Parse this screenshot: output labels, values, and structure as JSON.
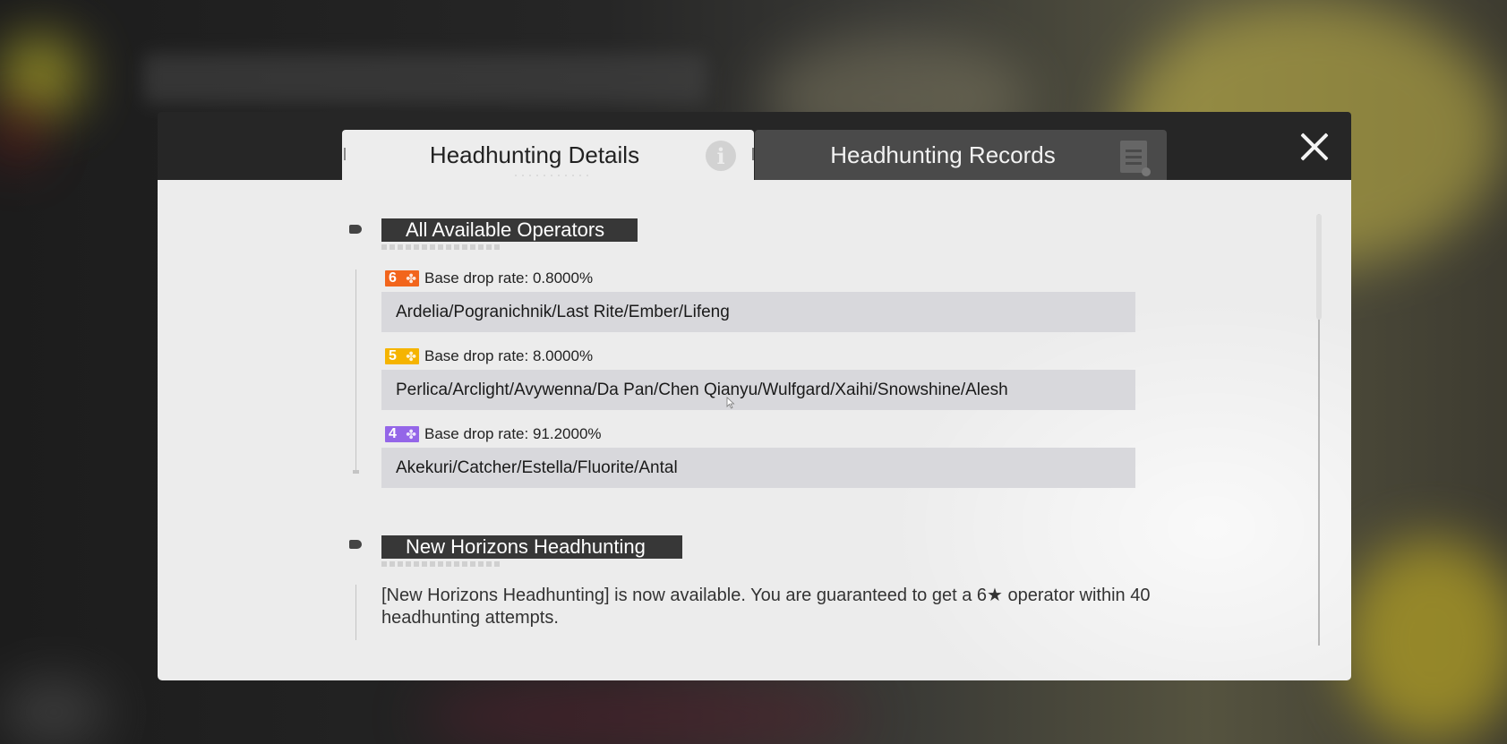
{
  "tabs": [
    {
      "label": "Headhunting Details",
      "active": true,
      "icon": "info-icon"
    },
    {
      "label": "Headhunting Records",
      "active": false,
      "icon": "document-icon"
    }
  ],
  "close_icon": "close-icon",
  "sections": {
    "available": {
      "title": "All Available Operators",
      "tiers": [
        {
          "rarity": "6",
          "badge_color": "#f2651c",
          "rate_text": "Base drop rate: 0.8000%",
          "operators": "Ardelia/Pogranichnik/Last Rite/Ember/Lifeng"
        },
        {
          "rarity": "5",
          "badge_color": "#f5b400",
          "rate_text": "Base drop rate: 8.0000%",
          "operators": "Perlica/Arclight/Avywenna/Da Pan/Chen Qianyu/Wulfgard/Xaihi/Snowshine/Alesh"
        },
        {
          "rarity": "4",
          "badge_color": "#9466e8",
          "rate_text": "Base drop rate: 91.2000%",
          "operators": "Akekuri/Catcher/Estella/Fluorite/Antal"
        }
      ]
    },
    "new_horizons": {
      "title": "New Horizons Headhunting",
      "description": "[New Horizons Headhunting] is now available. You are guaranteed to get a 6★ operator within 40 headhunting attempts."
    }
  }
}
